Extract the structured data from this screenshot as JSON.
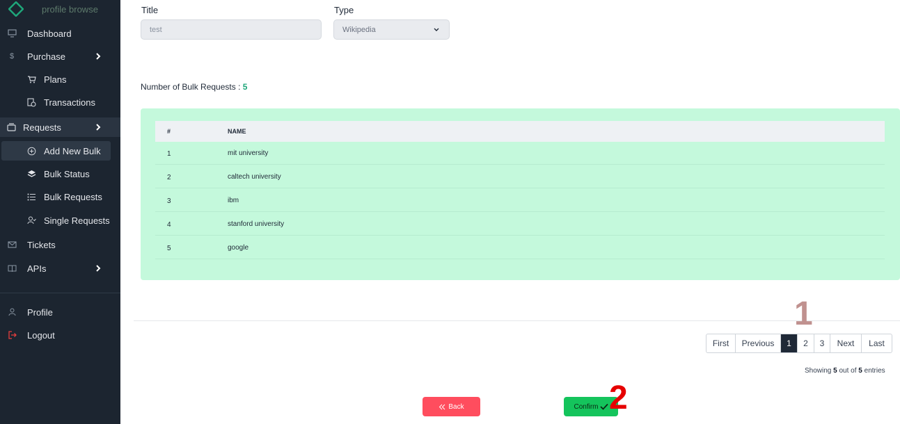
{
  "sidebar": {
    "brand": "profile browse",
    "items": [
      {
        "label": "Dashboard",
        "icon": "monitor-icon"
      },
      {
        "label": "Purchase",
        "icon": "dollar-icon",
        "has_chevron": true
      },
      {
        "label": "Plans",
        "icon": "cart-icon",
        "sub": true
      },
      {
        "label": "Transactions",
        "icon": "receipt-icon",
        "sub": true
      },
      {
        "label": "Requests",
        "icon": "folder-icon",
        "has_chevron": true,
        "active": true
      },
      {
        "label": "Add New Bulk",
        "icon": "plus-circle-icon",
        "sub": true,
        "active": true
      },
      {
        "label": "Bulk Status",
        "icon": "layers-icon",
        "sub": true
      },
      {
        "label": "Bulk Requests",
        "icon": "list-icon",
        "sub": true
      },
      {
        "label": "Single Requests",
        "icon": "user-check-icon",
        "sub": true
      },
      {
        "label": "Tickets",
        "icon": "mail-icon"
      },
      {
        "label": "APIs",
        "icon": "book-icon",
        "has_chevron": true
      },
      {
        "label": "Profile",
        "icon": "user-icon"
      },
      {
        "label": "Logout",
        "icon": "logout-icon",
        "color": "#e53e3e"
      }
    ]
  },
  "form": {
    "title_label": "Title",
    "title_value": "test",
    "type_label": "Type",
    "type_value": "Wikipedia"
  },
  "bulk": {
    "count_label": "Number of Bulk Requests :",
    "count": "5"
  },
  "table": {
    "headers": [
      "#",
      "NAME"
    ],
    "rows": [
      [
        "1",
        "mit university"
      ],
      [
        "2",
        "caltech university"
      ],
      [
        "3",
        "ibm"
      ],
      [
        "4",
        "stanford university"
      ],
      [
        "5",
        "google"
      ]
    ]
  },
  "pagination": {
    "first": "First",
    "previous": "Previous",
    "pages": [
      "1",
      "2",
      "3"
    ],
    "active_page": "1",
    "next": "Next",
    "last": "Last"
  },
  "entries": {
    "prefix": "Showing",
    "shown": "5",
    "middle": "out of",
    "total": "5",
    "suffix": "entries"
  },
  "buttons": {
    "back": "Back",
    "confirm": "Confirm"
  },
  "annotations": [
    "1",
    "2"
  ],
  "colors": {
    "sidebar_bg": "#1c2530",
    "table_bg": "#c4f9dc",
    "count_accent": "#1fa67a",
    "back_button": "#ff4d5e",
    "confirm_button": "#14c45c",
    "annotation_1": "#c0918f",
    "annotation_2": "#e60000"
  }
}
